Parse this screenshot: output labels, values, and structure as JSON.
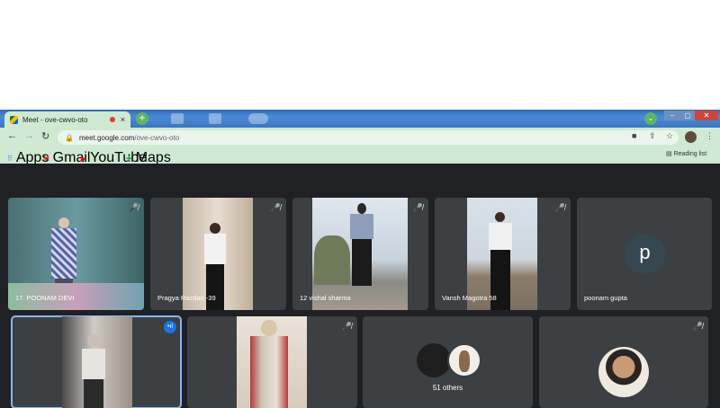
{
  "browser": {
    "tab_title": "Meet - ove-cwvo-oto",
    "tab_close": "×",
    "new_tab": "+",
    "url_host": "meet.google.com",
    "url_path": "/ove-cwvo-oto",
    "window_controls": [
      "–",
      "▢",
      "✕"
    ]
  },
  "bookmarks": {
    "items": [
      "Apps",
      "Gmail",
      "YouTube",
      "Maps"
    ],
    "reading_list": "Reading list"
  },
  "meet": {
    "participants": [
      "17. POONAM DEVI",
      "Pragya Razdan -39",
      "12 vishal sharma",
      "Vansh Magotra 58",
      "poonam gupta"
    ],
    "avatar_letter": "p",
    "others_label": "51 others",
    "colors": {
      "stage": "#202124",
      "tile": "#3c4043",
      "speaking": "#1a73e8"
    }
  }
}
